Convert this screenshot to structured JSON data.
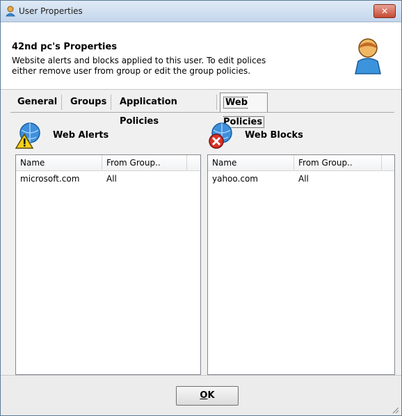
{
  "window": {
    "title": "User Properties",
    "close_glyph": "✕"
  },
  "header": {
    "title": "42nd pc's Properties",
    "description_line1": "Website alerts and blocks applied to this user.  To edit polices",
    "description_line2": "either remove user from group or edit the group policies."
  },
  "tabs": [
    {
      "label": "General",
      "active": false
    },
    {
      "label": "Groups",
      "active": false
    },
    {
      "label": "Application Policies",
      "active": false
    },
    {
      "label": "Web Policies",
      "active": true
    }
  ],
  "alerts": {
    "title": "Web Alerts",
    "icon": "warning-globe-icon",
    "columns": [
      "Name",
      "From Group.."
    ],
    "rows": [
      {
        "name": "microsoft.com",
        "group": "All"
      }
    ]
  },
  "blocks": {
    "title": "Web Blocks",
    "icon": "blocked-globe-icon",
    "columns": [
      "Name",
      "From Group.."
    ],
    "rows": [
      {
        "name": "yahoo.com",
        "group": "All"
      }
    ]
  },
  "footer": {
    "ok_label_underlined": "O",
    "ok_label_rest": "K"
  },
  "colors": {
    "title_bar": "#c4d6ec",
    "close_button": "#c64a33",
    "header_bg": "#ffffff",
    "dialog_bg": "#f0f0f0"
  }
}
